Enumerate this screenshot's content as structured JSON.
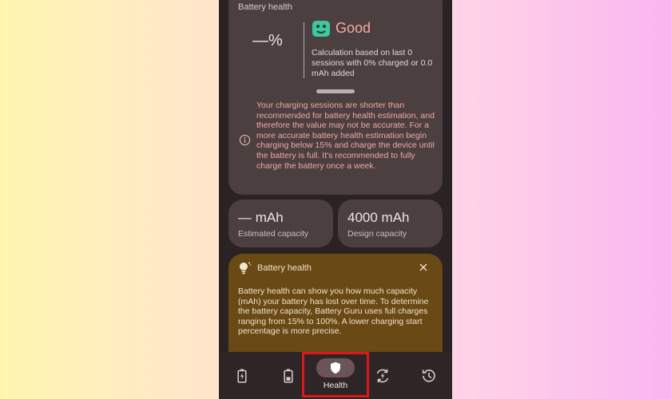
{
  "health_card": {
    "title": "Battery health",
    "percent": "—%",
    "status": "Good",
    "calculation": "Calculation based on last 0 sessions with 0% charged or 0.0 mAh added",
    "warning": "Your charging sessions are shorter than recommended for battery health estimation, and therefore the value may not be accurate. For a more accurate battery health estimation begin charging below 15% and charge the device until the battery is full. It's recommended to fully charge the battery once a week."
  },
  "capacity": {
    "estimated_value": "— mAh",
    "estimated_label": "Estimated capacity",
    "design_value": "4000 mAh",
    "design_label": "Design capacity"
  },
  "tip_card": {
    "title": "Battery health",
    "body": "Battery health can show you how much capacity (mAh) your battery has lost over time. To determine the battery capacity, Battery Guru uses full charges ranging from 15% to 100%. A lower charging start percentage is more precise."
  },
  "bottom_nav": {
    "items": [
      {
        "icon": "battery-charging-icon"
      },
      {
        "icon": "battery-icon"
      },
      {
        "icon": "shield-icon",
        "label": "Health"
      },
      {
        "icon": "charging-cycle-icon"
      },
      {
        "icon": "history-icon"
      }
    ]
  },
  "colors": {
    "background": "#2b2224",
    "card": "#4b3f40",
    "tip_card": "#6a4a14",
    "status_good": "#f4a8a8",
    "warning_text": "#f2a9a3",
    "highlight": "#e0161b"
  }
}
